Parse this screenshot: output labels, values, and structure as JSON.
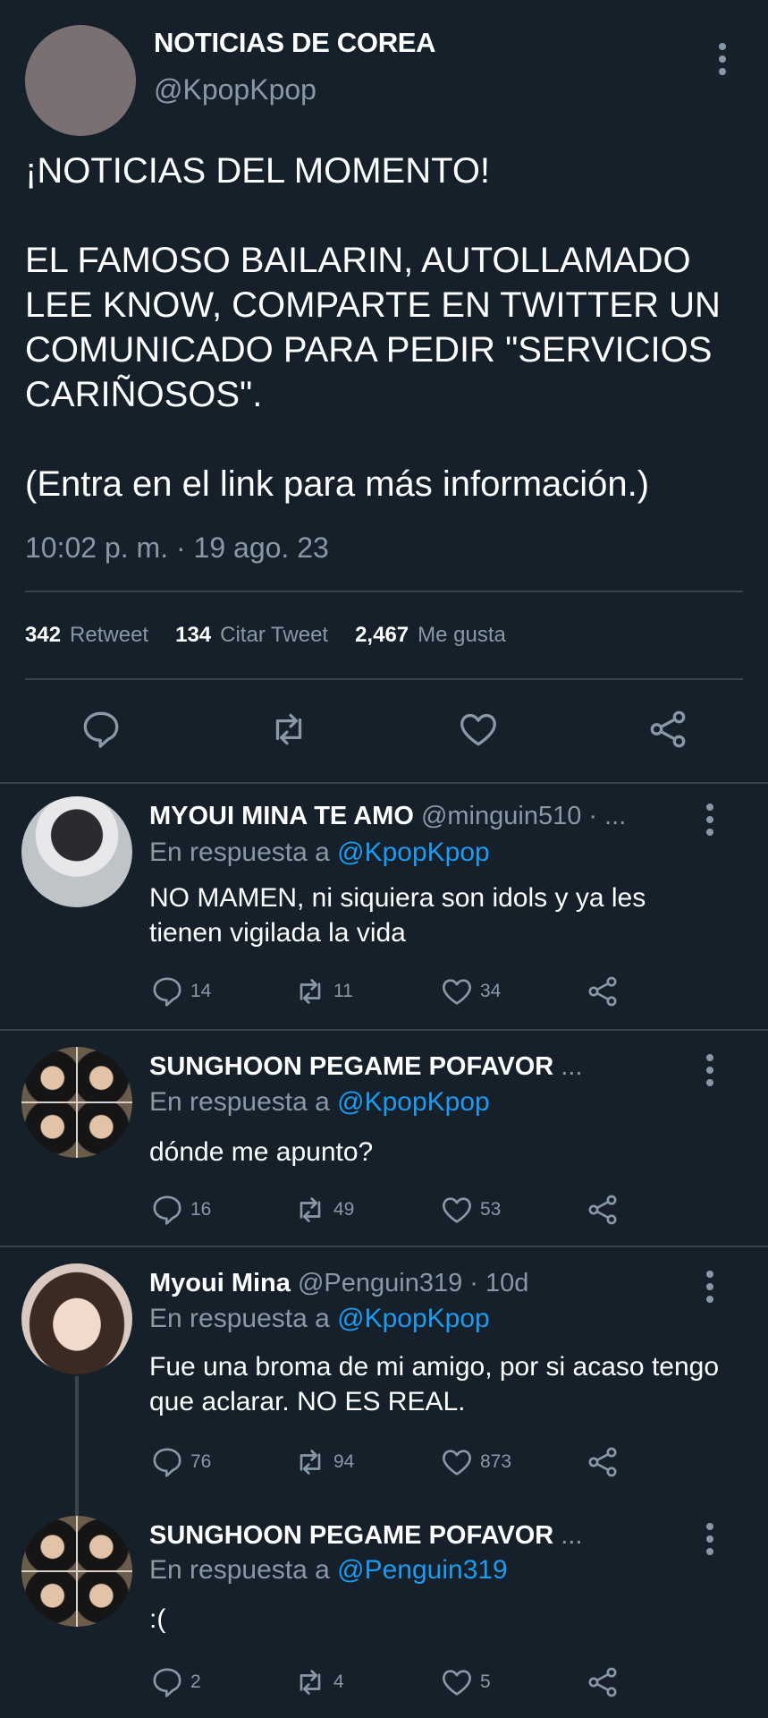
{
  "main_tweet": {
    "author_name": "NOTICIAS DE COREA",
    "author_handle": "@KpopKpop",
    "body": "¡NOTICIAS DEL MOMENTO!\n\nEL FAMOSO BAILARIN, AUTOLLAMADO LEE KNOW, COMPARTE EN TWITTER UN COMUNICADO PARA PEDIR \"SERVICIOS CARIÑOSOS\".\n\n(Entra en el link para más información.)",
    "timestamp": "10:02 p. m. · 19 ago. 23",
    "stats": {
      "retweets_count": "342",
      "retweets_label": "Retweet",
      "quotes_count": "134",
      "quotes_label": "Citar Tweet",
      "likes_count": "2,467",
      "likes_label": "Me gusta"
    }
  },
  "replies": [
    {
      "name": "MYOUI MINA TE AMO",
      "meta": "@minguin510 · ...",
      "reply_prefix": "En respuesta a",
      "reply_to": "@KpopKpop",
      "text": "NO MAMEN, ni siquiera son idols y ya les tienen vigilada la vida",
      "comments": "14",
      "retweets": "11",
      "likes": "34"
    },
    {
      "name": "SUNGHOON PEGAME POFAVOR",
      "meta": "...",
      "reply_prefix": "En respuesta a",
      "reply_to": "@KpopKpop",
      "text": "dónde me apunto?",
      "comments": "16",
      "retweets": "49",
      "likes": "53"
    },
    {
      "name": "Myoui Mina",
      "meta": "@Penguin319 · 10d",
      "reply_prefix": "En respuesta a",
      "reply_to": "@KpopKpop",
      "text": "Fue una broma de mi amigo, por si acaso tengo que aclarar. NO ES REAL.",
      "comments": "76",
      "retweets": "94",
      "likes": "873"
    },
    {
      "name": "SUNGHOON PEGAME POFAVOR",
      "meta": "...",
      "reply_prefix": "En respuesta a",
      "reply_to": "@Penguin319",
      "text": ":(",
      "comments": "2",
      "retweets": "4",
      "likes": "5"
    }
  ],
  "icons": {
    "comment": "comment-icon",
    "retweet": "retweet-icon",
    "like": "heart-icon",
    "share": "share-icon",
    "more": "more-options-icon"
  },
  "colors": {
    "background": "#15202b",
    "divider": "#38444d",
    "muted_text": "#8899a6",
    "link": "#1d9bf0"
  }
}
